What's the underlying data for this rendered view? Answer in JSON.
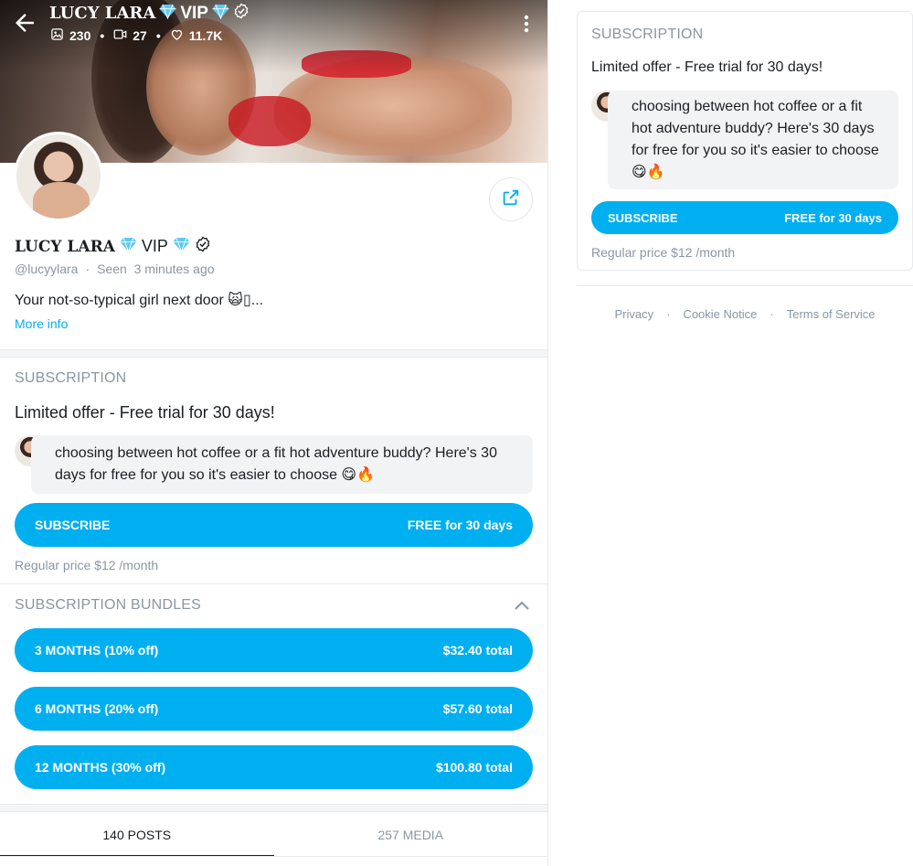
{
  "header": {
    "name": "LUCY LARA",
    "vip_label": "VIP",
    "photos_count": "230",
    "videos_count": "27",
    "likes_count": "11.7K"
  },
  "profile": {
    "name": "LUCY LARA",
    "vip_label": "VIP",
    "handle": "@lucyylara",
    "separator": "·",
    "seen": "Seen  3 minutes ago",
    "bio": "Your not-so-typical girl next door 🙀▯...",
    "more_info": "More info"
  },
  "subscription": {
    "section_title": "SUBSCRIPTION",
    "offer": "Limited offer - Free trial for 30 days!",
    "message": "choosing between hot coffee or a fit hot adventure buddy? Here's 30 days for free for you so it's easier to choose 😋🔥",
    "cta_label": "SUBSCRIBE",
    "cta_value": "FREE for 30 days",
    "regular_price": "Regular price $12 /month"
  },
  "bundles": {
    "section_title": "SUBSCRIPTION BUNDLES",
    "items": [
      {
        "label": "3 MONTHS (10% off)",
        "value": "$32.40 total"
      },
      {
        "label": "6 MONTHS (20% off)",
        "value": "$57.60 total"
      },
      {
        "label": "12 MONTHS (30% off)",
        "value": "$100.80 total"
      }
    ]
  },
  "tabs": [
    {
      "label": "140 POSTS"
    },
    {
      "label": "257 MEDIA"
    }
  ],
  "sidebar_card": {
    "section_title": "SUBSCRIPTION",
    "offer": "Limited offer - Free trial for 30 days!",
    "message": "choosing between hot coffee or a fit hot adventure buddy? Here's 30 days for free for you so it's easier to choose 😋🔥",
    "cta_label": "SUBSCRIBE",
    "cta_value": "FREE for 30 days",
    "regular_price": "Regular price $12 /month"
  },
  "footer": {
    "privacy": "Privacy",
    "cookie": "Cookie Notice",
    "terms": "Terms of Service",
    "separator": "·"
  },
  "colors": {
    "accent": "#00aff0",
    "muted": "#8a96a3",
    "text": "#1b1f24"
  },
  "icons": [
    "back-arrow-icon",
    "diamond-icon",
    "verified-icon",
    "image-icon",
    "video-icon",
    "heart-icon",
    "kebab-menu-icon",
    "share-icon",
    "chevron-up-icon"
  ]
}
